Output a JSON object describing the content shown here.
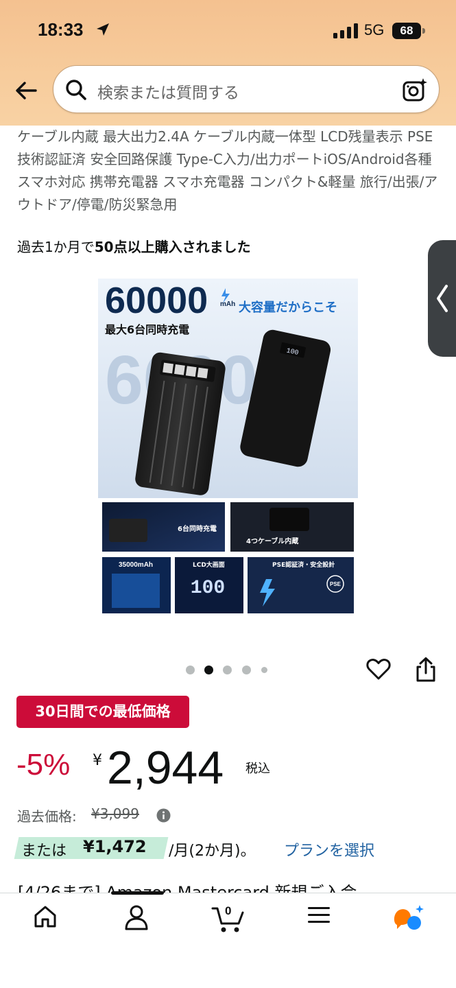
{
  "status_bar": {
    "time": "18:33",
    "network": "5G",
    "battery": "68"
  },
  "search": {
    "placeholder": "検索または質問する"
  },
  "product": {
    "title_text": "ケーブル内蔵 最大出力2.4A ケーブル内蔵一体型 LCD残量表示 PSE技術認証済 安全回路保護 Type-C入力/出力ポートiOS/Android各種スマホ対応 携帯充電器 スマホ充電器 コンパクト&軽量 旅行/出張/アウトドア/停電/防災緊急用",
    "purchases_prefix": "過去1か月で",
    "purchases_bold": "50点以上購入されました",
    "image": {
      "capacity_big": "60000",
      "capacity_unit": "mAh",
      "headline": "大容量だからこそ",
      "subhead": "最大6台同時充電",
      "watermark": "60000",
      "panel_1": "6台同時充電",
      "panel_2": "4つケーブル内蔵",
      "panel_3": "35000mAh",
      "panel_4": "LCD大画面",
      "panel_5": "PSE認証済・安全設計",
      "lcd_readout": "100",
      "screen_readout": "100",
      "pse_mark": "PSE"
    }
  },
  "carousel": {
    "active_index": 1,
    "count": 5
  },
  "deal": {
    "badge": "30日間での最低価格",
    "discount": "-5%",
    "currency": "¥",
    "price": "2,944",
    "tax_note": "税込",
    "past_label": "過去価格:",
    "past_value": "¥3,099",
    "installment_prefix": "または",
    "installment_amount": "¥1,472",
    "installment_period": "/月(2か月)。",
    "plan_link": "プランを選択"
  },
  "promo": {
    "text": "[4/26まで] Amazon Mastercard 新規ご入会"
  },
  "nav": {
    "cart_count": "0"
  },
  "colors": {
    "header_bg": "#f6c796",
    "deal_red": "#cc0c39",
    "link_blue": "#2162a1",
    "installment_highlight": "#c6ecd9",
    "rufus_orange": "#ff7a00",
    "rufus_blue": "#1a8cff"
  }
}
